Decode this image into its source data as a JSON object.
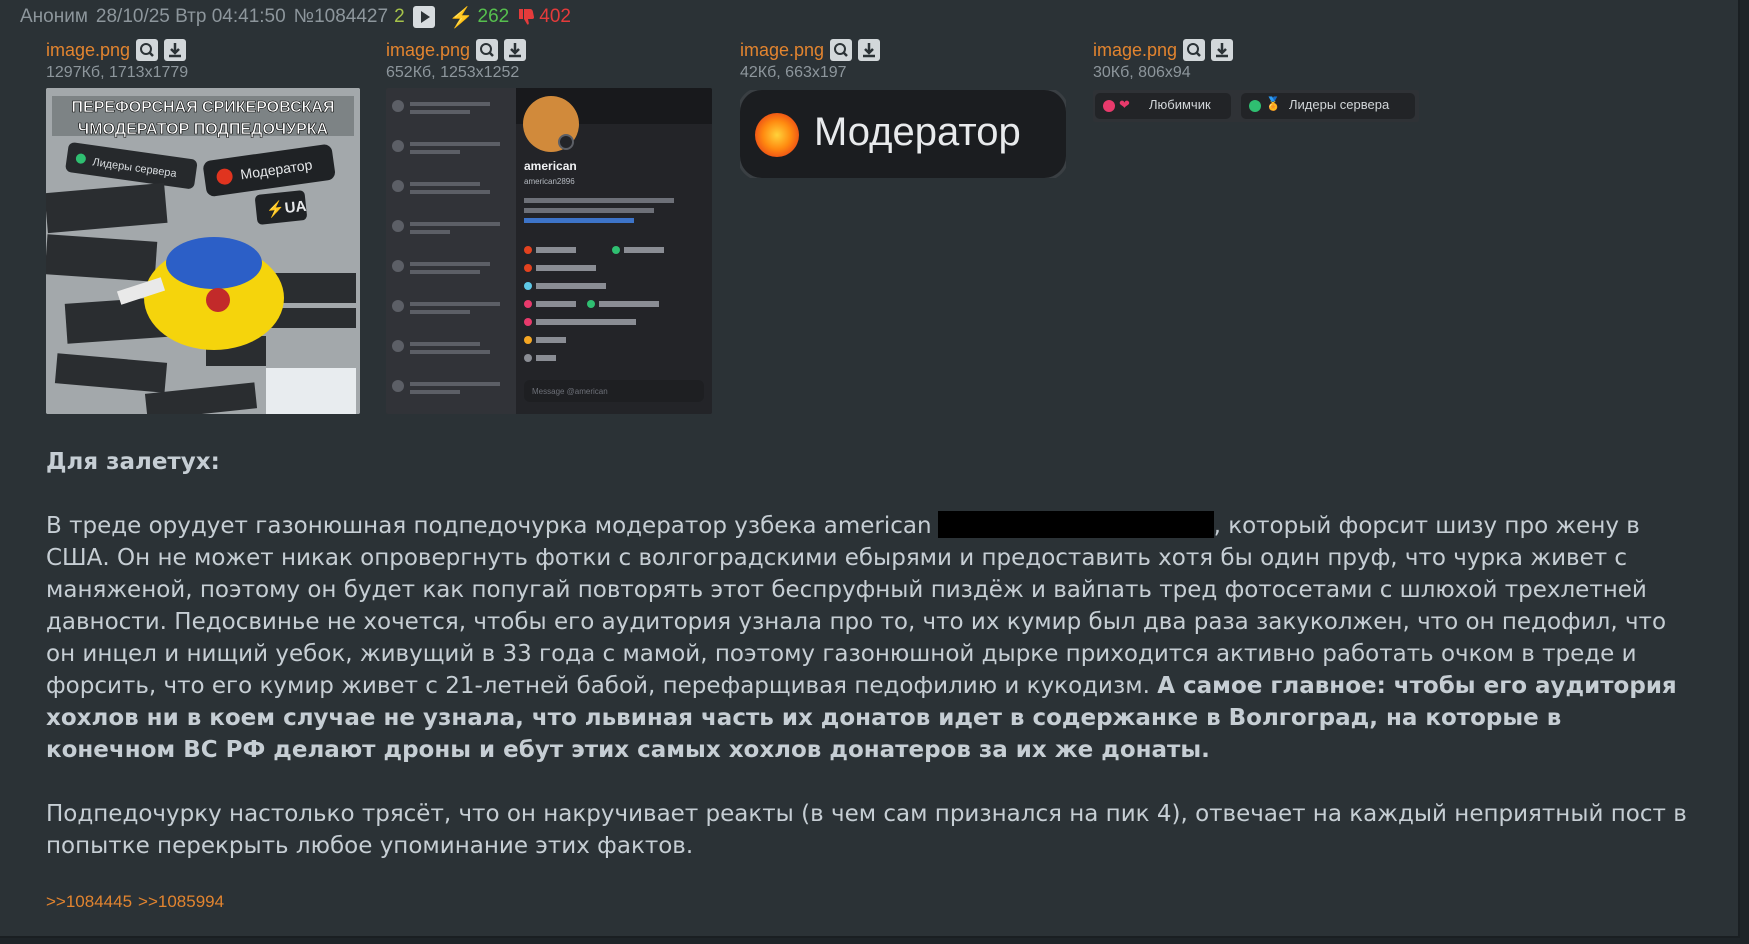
{
  "post": {
    "author": "Аноним",
    "date": "28/10/25 Втр 04:41:50",
    "number": "№1084427",
    "count": "2",
    "likes": "262",
    "dislikes": "402"
  },
  "files": [
    {
      "name": "image.png",
      "meta": "1297Кб, 1713x1779"
    },
    {
      "name": "image.png",
      "meta": "652Кб, 1253x1252"
    },
    {
      "name": "image.png",
      "meta": "42Кб, 663x197"
    },
    {
      "name": "image.png",
      "meta": "30Кб, 806x94"
    }
  ],
  "thumbs": {
    "t1": {
      "line1": "ПЕРЕФОРСНАЯ СРИКЕРОВСКАЯ",
      "line2": "ЧМОДЕРАТОР ПОДПЕДОЧУРКА",
      "tag_leaders": "Лидеры сервера",
      "tag_moder": "Модератор",
      "tag_ua": "⚡UA"
    },
    "t2": {
      "username": "american",
      "handle": "american2896",
      "message_placeholder": "Message @american"
    },
    "t3": {
      "label": "Модератор"
    },
    "t4": {
      "role1": "Любимчик",
      "role2": "Лидеры сервера"
    }
  },
  "body": {
    "heading": "Для залетух:",
    "p1_a": "В треде орудует газонюшная подпедочурка модератор узбека american",
    "p1_b": ", который форсит шизу про жену в США. Он не может никак опровергнуть фотки с волгоградскими ебырями и предоставить хотя бы один пруф, что чурка живет с маняженой, поэтому он будет как попугай повторять этот беспруфный пиздёж и вайпать тред фотосетами с шлюхой трехлетней давности. Педосвинье не хочется, чтобы его аудитория узнала про то, что их кумир был два раза закуколжен, что он педофил, что он инцел и нищий уебок, живущий в 33 года с мамой, поэтому газонюшной дырке приходится активно работать очком в треде и форсить, что его кумир живет с 21-летней бабой, перефарщивая педофилию и кукодизм.",
    "p1_bold": "А самое главное: чтобы его аудитория хохлов ни в коем случае не узнала, что львиная часть их донатов идет в содержанке в Волгоград, на которые в конечном ВС РФ делают дроны и ебут этих самых хохлов донатеров за их же донаты.",
    "p2": "Подпедочурку настолько трясёт, что он накручивает реакты (в чем сам признался на пик 4), отвечает на каждый неприятный пост в попытке перекрыть любое упоминание этих фактов."
  },
  "replies": [
    ">>1084445",
    ">>1085994"
  ],
  "colors": {
    "background": "#2b3236",
    "text": "#c6ced4",
    "link": "#e2842f",
    "likes": "#56c04e",
    "dislikes": "#e43b3b"
  }
}
